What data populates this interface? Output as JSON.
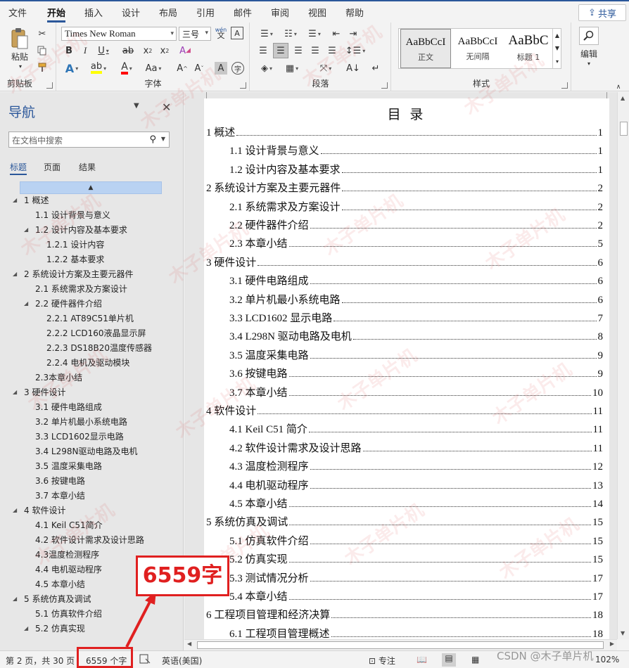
{
  "ribbon": {
    "tabs": [
      "文件",
      "开始",
      "插入",
      "设计",
      "布局",
      "引用",
      "邮件",
      "审阅",
      "视图",
      "帮助"
    ],
    "active_tab": "开始",
    "share_label": "共享",
    "paste_label": "粘贴",
    "clipboard_label": "剪贴板",
    "font_name": "Times New Roman",
    "font_size": "三号",
    "font_label": "字体",
    "paragraph_label": "段落",
    "styles_label": "样式",
    "edit_label": "编辑",
    "wen_icon_text": "wén",
    "aa_button": "Aa",
    "styles": [
      {
        "sample": "AaBbCcI",
        "name": "正文"
      },
      {
        "sample": "AaBbCcI",
        "name": "无间隔"
      },
      {
        "sample": "AaBbC",
        "name": "标题 1"
      }
    ],
    "icons": [
      "cut-icon",
      "copy-icon",
      "format-painter-icon",
      "bold-icon",
      "italic-icon",
      "underline-icon",
      "strikethrough-icon",
      "subscript-icon",
      "superscript-icon",
      "clear-format-icon",
      "text-effect-icon",
      "highlight-icon",
      "font-color-icon",
      "change-case-icon",
      "grow-font-icon",
      "shrink-font-icon",
      "char-shading-icon",
      "enclose-char-icon",
      "bullets-icon",
      "numbering-icon",
      "multilevel-list-icon",
      "decrease-indent-icon",
      "increase-indent-icon",
      "align-left-icon",
      "center-icon",
      "align-right-icon",
      "justify-icon",
      "distributed-icon",
      "line-spacing-icon",
      "shading-icon",
      "borders-icon",
      "chinese-layout-icon",
      "sort-icon",
      "show-marks-icon",
      "search-icon"
    ]
  },
  "nav": {
    "title": "导航",
    "search_placeholder": "在文档中搜索",
    "tabs": [
      "标题",
      "页面",
      "结果"
    ],
    "items": [
      {
        "label": "1 概述",
        "level": 1,
        "expanded": true
      },
      {
        "label": "1.1 设计背景与意义",
        "level": 2
      },
      {
        "label": "1.2 设计内容及基本要求",
        "level": 2,
        "expanded": true
      },
      {
        "label": "1.2.1 设计内容",
        "level": 3
      },
      {
        "label": "1.2.2 基本要求",
        "level": 3
      },
      {
        "label": "2 系统设计方案及主要元器件",
        "level": 1,
        "expanded": true
      },
      {
        "label": "2.1 系统需求及方案设计",
        "level": 2
      },
      {
        "label": "2.2 硬件器件介绍",
        "level": 2,
        "expanded": true
      },
      {
        "label": "2.2.1 AT89C51单片机",
        "level": 3
      },
      {
        "label": "2.2.2 LCD160液晶显示屏",
        "level": 3
      },
      {
        "label": "2.2.3 DS18B20温度传感器",
        "level": 3
      },
      {
        "label": "2.2.4 电机及驱动模块",
        "level": 3
      },
      {
        "label": "2.3本章小结",
        "level": 2
      },
      {
        "label": "3 硬件设计",
        "level": 1,
        "expanded": true
      },
      {
        "label": "3.1 硬件电路组成",
        "level": 2
      },
      {
        "label": "3.2 单片机最小系统电路",
        "level": 2
      },
      {
        "label": "3.3 LCD1602显示电路",
        "level": 2
      },
      {
        "label": "3.4 L298N驱动电路及电机",
        "level": 2
      },
      {
        "label": "3.5 温度采集电路",
        "level": 2
      },
      {
        "label": "3.6 按键电路",
        "level": 2
      },
      {
        "label": "3.7 本章小结",
        "level": 2
      },
      {
        "label": "4 软件设计",
        "level": 1,
        "expanded": true
      },
      {
        "label": "4.1 Keil C51简介",
        "level": 2
      },
      {
        "label": "4.2 软件设计需求及设计思路",
        "level": 2
      },
      {
        "label": "4.3温度检测程序",
        "level": 2
      },
      {
        "label": "4.4 电机驱动程序",
        "level": 2
      },
      {
        "label": "4.5 本章小结",
        "level": 2
      },
      {
        "label": "5 系统仿真及调试",
        "level": 1,
        "expanded": true
      },
      {
        "label": "5.1 仿真软件介绍",
        "level": 2
      },
      {
        "label": "5.2 仿真实现",
        "level": 2,
        "expanded": true
      }
    ]
  },
  "document": {
    "toc_title": "目 录",
    "toc": [
      {
        "text": "1 概述",
        "page": "1",
        "level": 1
      },
      {
        "text": "1.1 设计背景与意义",
        "page": "1",
        "level": 2
      },
      {
        "text": "1.2 设计内容及基本要求",
        "page": "1",
        "level": 2
      },
      {
        "text": "2 系统设计方案及主要元器件",
        "page": "2",
        "level": 1
      },
      {
        "text": "2.1 系统需求及方案设计",
        "page": "2",
        "level": 2
      },
      {
        "text": "2.2 硬件器件介绍",
        "page": "2",
        "level": 2
      },
      {
        "text": "2.3 本章小结",
        "page": "5",
        "level": 2
      },
      {
        "text": "3 硬件设计",
        "page": "6",
        "level": 1
      },
      {
        "text": "3.1 硬件电路组成",
        "page": "6",
        "level": 2
      },
      {
        "text": "3.2 单片机最小系统电路",
        "page": "6",
        "level": 2
      },
      {
        "text": "3.3 LCD1602 显示电路",
        "page": "7",
        "level": 2
      },
      {
        "text": "3.4 L298N 驱动电路及电机",
        "page": "8",
        "level": 2
      },
      {
        "text": "3.5 温度采集电路",
        "page": "9",
        "level": 2
      },
      {
        "text": "3.6 按键电路",
        "page": "9",
        "level": 2
      },
      {
        "text": "3.7 本章小结",
        "page": "10",
        "level": 2
      },
      {
        "text": "4 软件设计",
        "page": "11",
        "level": 1
      },
      {
        "text": "4.1 Keil C51 简介",
        "page": "11",
        "level": 2
      },
      {
        "text": "4.2 软件设计需求及设计思路",
        "page": "11",
        "level": 2
      },
      {
        "text": "4.3 温度检测程序",
        "page": "12",
        "level": 2
      },
      {
        "text": "4.4 电机驱动程序",
        "page": "13",
        "level": 2
      },
      {
        "text": "4.5 本章小结",
        "page": "14",
        "level": 2
      },
      {
        "text": "5 系统仿真及调试",
        "page": "15",
        "level": 1
      },
      {
        "text": "5.1 仿真软件介绍",
        "page": "15",
        "level": 2
      },
      {
        "text": "5.2 仿真实现",
        "page": "15",
        "level": 2
      },
      {
        "text": "5.3 测试情况分析",
        "page": "17",
        "level": 2
      },
      {
        "text": "5.4 本章小结",
        "page": "17",
        "level": 2
      },
      {
        "text": "6 工程项目管理和经济决算",
        "page": "18",
        "level": 1
      },
      {
        "text": "6.1 工程项目管理概述",
        "page": "18",
        "level": 2
      }
    ]
  },
  "status": {
    "page": "第 2 页，共 30 页",
    "words": "6559 个字",
    "language": "英语(美国)",
    "focus": "专注",
    "zoom": "102%"
  },
  "annotation": {
    "callout": "6559字",
    "color": "#e02020"
  },
  "watermark": {
    "text": "木子单片机",
    "csdn": "CSDN @木子单片机"
  },
  "colors": {
    "accent": "#2b579a",
    "highlight": "#ffff00",
    "font_color": "#ff0000"
  }
}
